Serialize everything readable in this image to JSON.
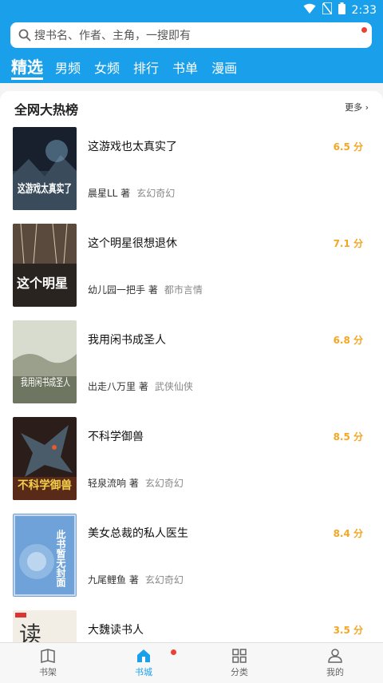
{
  "status_bar": {
    "time": "2:33"
  },
  "search": {
    "placeholder": "搜书名、作者、主角，一搜即有"
  },
  "tabs": [
    {
      "label": "精选",
      "active": true
    },
    {
      "label": "男频"
    },
    {
      "label": "女频"
    },
    {
      "label": "排行"
    },
    {
      "label": "书单"
    },
    {
      "label": "漫画"
    }
  ],
  "section": {
    "title": "全网大热榜",
    "more": "更多"
  },
  "books": [
    {
      "title": "这游戏也太真实了",
      "author": "晨星LL 著",
      "genre": "玄幻奇幻",
      "score": "6.5 分",
      "cover_text": "这游戏太真实了"
    },
    {
      "title": "这个明星很想退休",
      "author": "幼儿园一把手 著",
      "genre": "都市言情",
      "score": "7.1 分",
      "cover_text": "这个明星"
    },
    {
      "title": "我用闲书成圣人",
      "author": "出走八万里 著",
      "genre": "武侠仙侠",
      "score": "6.8 分",
      "cover_text": "我用闲书成圣人"
    },
    {
      "title": "不科学御兽",
      "author": "轻泉流响 著",
      "genre": "玄幻奇幻",
      "score": "8.5 分",
      "cover_text": "不科学御兽"
    },
    {
      "title": "美女总裁的私人医生",
      "author": "九尾鲤鱼 著",
      "genre": "玄幻奇幻",
      "score": "8.4 分",
      "cover_text": "此书暂无封面"
    },
    {
      "title": "大魏读书人",
      "author": "",
      "genre": "",
      "score": "3.5 分",
      "cover_text": "读"
    }
  ],
  "bottom_nav": [
    {
      "label": "书架",
      "icon": "bookshelf-icon"
    },
    {
      "label": "书城",
      "icon": "home-icon",
      "active": true
    },
    {
      "label": "分类",
      "icon": "category-icon"
    },
    {
      "label": "我的",
      "icon": "user-icon"
    }
  ],
  "colors": {
    "primary": "#1a9fea",
    "score": "#f5a623",
    "badge": "#e94235"
  }
}
